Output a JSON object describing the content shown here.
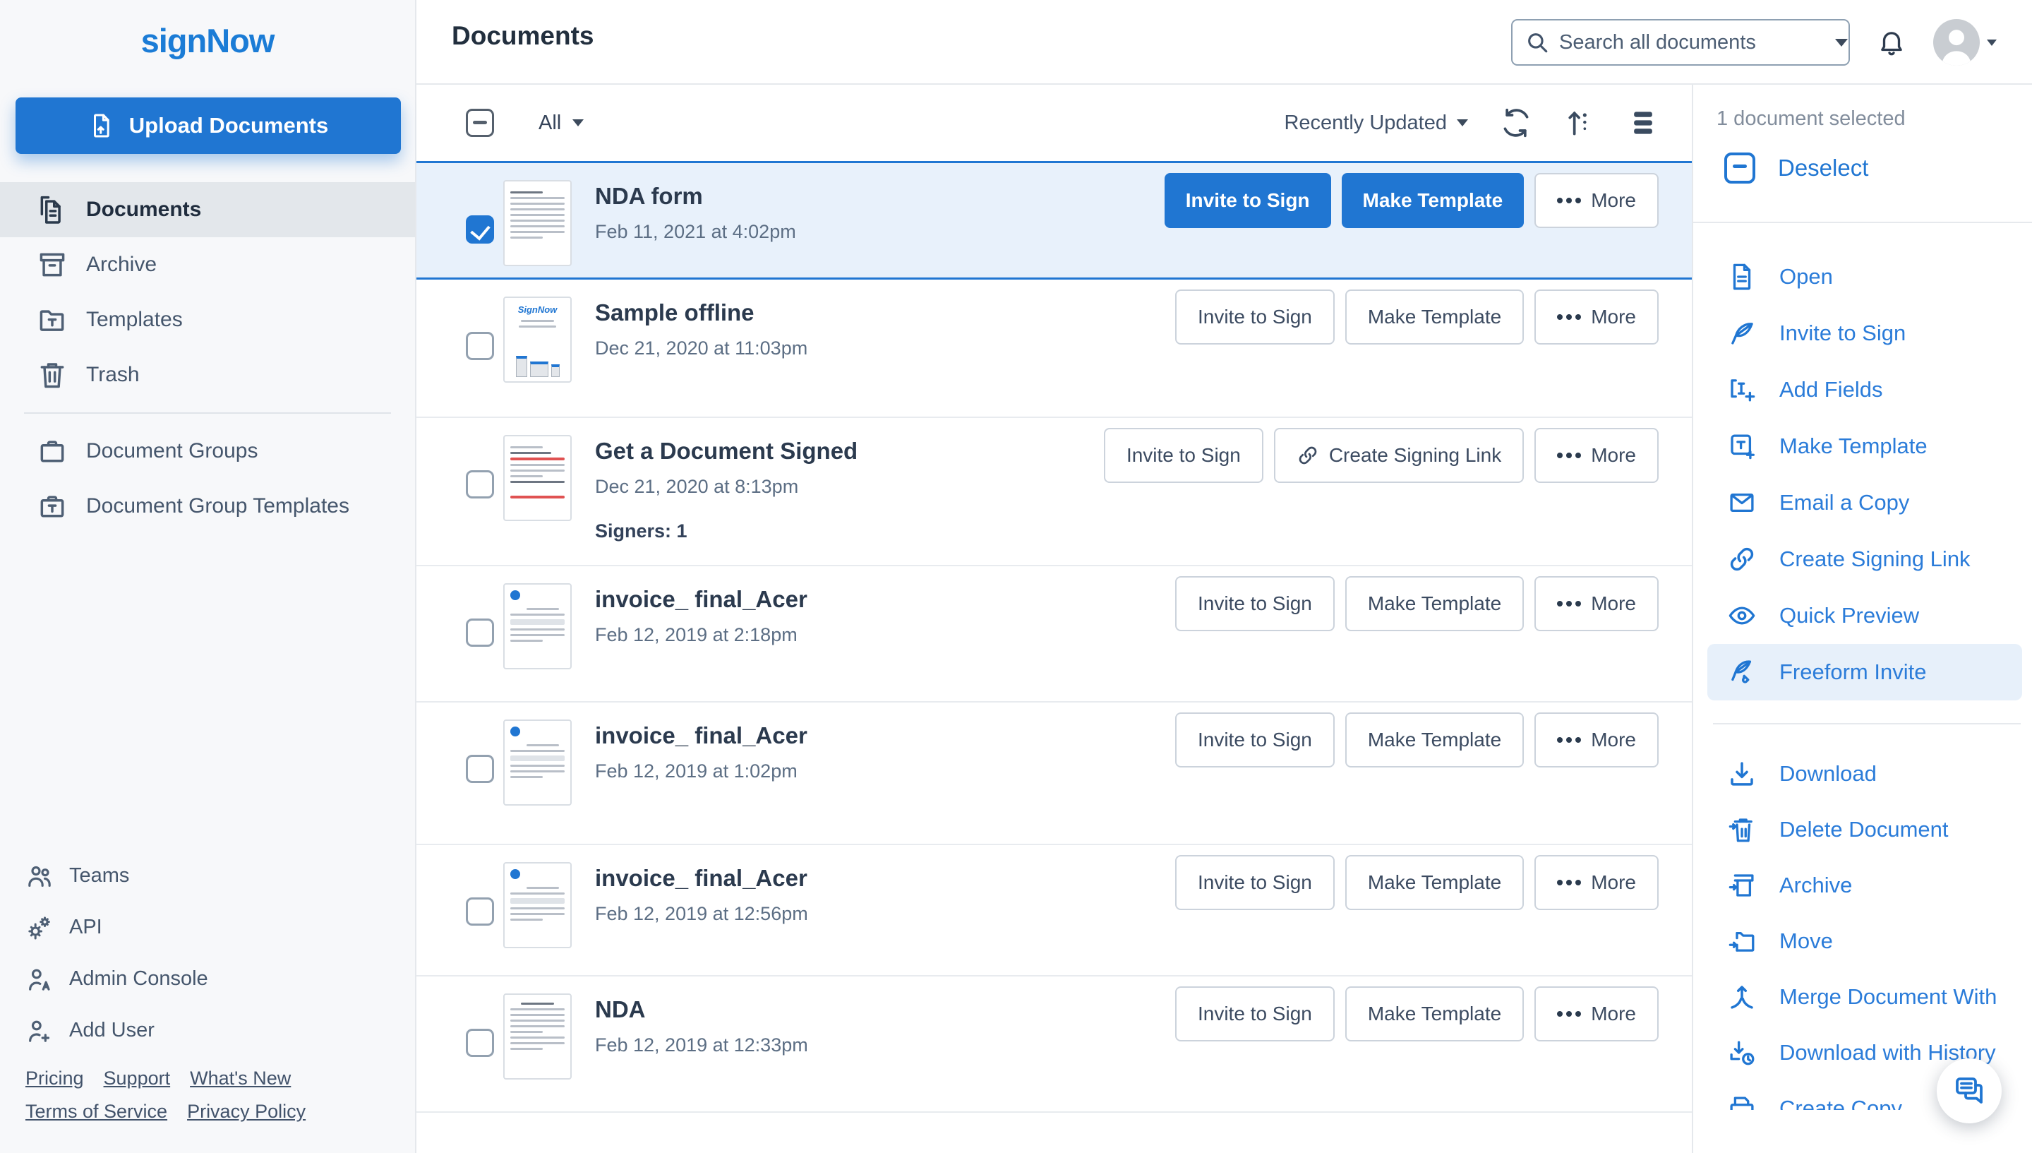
{
  "brand": {
    "name": "signNow",
    "accent": "#2076d2"
  },
  "sidebar": {
    "upload_button": "Upload Documents",
    "nav": [
      {
        "label": "Documents",
        "icon": "documents-icon",
        "active": true
      },
      {
        "label": "Archive",
        "icon": "archive-icon",
        "active": false
      },
      {
        "label": "Templates",
        "icon": "templates-icon",
        "active": false
      },
      {
        "label": "Trash",
        "icon": "trash-icon",
        "active": false
      }
    ],
    "groups": [
      {
        "label": "Document Groups",
        "icon": "briefcase-icon"
      },
      {
        "label": "Document Group Templates",
        "icon": "briefcase-template-icon"
      }
    ],
    "tools": [
      {
        "label": "Teams",
        "icon": "teams-icon"
      },
      {
        "label": "API",
        "icon": "gears-icon"
      },
      {
        "label": "Admin Console",
        "icon": "admin-person-icon"
      },
      {
        "label": "Add User",
        "icon": "add-user-icon"
      }
    ],
    "footer_links_row1": [
      "Pricing",
      "Support",
      "What's New"
    ],
    "footer_links_row2": [
      "Terms of Service",
      "Privacy Policy"
    ]
  },
  "header": {
    "title": "Documents",
    "search_placeholder": "Search all documents"
  },
  "toolbar": {
    "filter": "All",
    "sort": "Recently Updated"
  },
  "actions": {
    "invite": "Invite to Sign",
    "make_template": "Make Template",
    "more": "More",
    "create_signing_link": "Create Signing Link"
  },
  "documents": [
    {
      "title": "NDA form",
      "date": "Feb 11, 2021 at 4:02pm",
      "selected": true
    },
    {
      "title": "Sample offline",
      "date": "Dec 21, 2020 at 11:03pm",
      "selected": false
    },
    {
      "title": "Get a Document Signed",
      "date": "Dec 21, 2020 at 8:13pm",
      "signers": "Signers: 1",
      "selected": false
    },
    {
      "title": "invoice_ final_Acer",
      "date": "Feb 12, 2019 at 2:18pm",
      "selected": false
    },
    {
      "title": "invoice_ final_Acer",
      "date": "Feb 12, 2019 at 1:02pm",
      "selected": false
    },
    {
      "title": "invoice_ final_Acer",
      "date": "Feb 12, 2019 at 12:56pm",
      "selected": false
    },
    {
      "title": "NDA",
      "date": "Feb 12, 2019 at 12:33pm",
      "selected": false
    }
  ],
  "panel": {
    "selected_count_text": "1 document selected",
    "deselect_label": "Deselect",
    "primary_actions": [
      "Open",
      "Invite to Sign",
      "Add Fields",
      "Make Template",
      "Email a Copy",
      "Create Signing Link",
      "Quick Preview",
      "Freeform Invite"
    ],
    "highlighted_action": "Freeform Invite",
    "secondary_actions": [
      "Download",
      "Delete Document",
      "Archive",
      "Move",
      "Merge Document With",
      "Download with History",
      "Create Copy"
    ]
  }
}
